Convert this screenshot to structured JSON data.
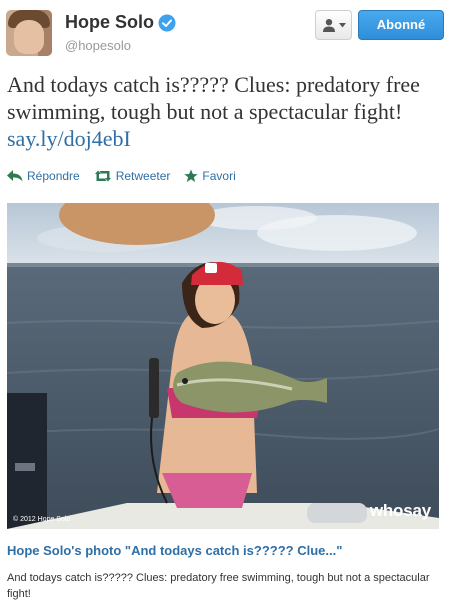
{
  "profile": {
    "name": "Hope Solo",
    "handle": "@hopesolo",
    "verified": true,
    "avatar": "profile-photo"
  },
  "buttons": {
    "user_menu_icon": "user-icon",
    "follow_label": "Abonné"
  },
  "tweet": {
    "text": "And todays catch is????? Clues: predatory free swimming, tough but not a spectacular fight! ",
    "link": "say.ly/doj4ebI"
  },
  "actions": [
    {
      "label": "Répondre",
      "icon": "reply-icon"
    },
    {
      "label": "Retweeter",
      "icon": "retweet-icon"
    },
    {
      "label": "Favori",
      "icon": "star-icon"
    }
  ],
  "media": {
    "copyright": "© 2012 Hope Solo",
    "watermark": "whosay"
  },
  "card": {
    "title": "Hope Solo's photo \"And todays catch is????? Clue...\"",
    "description": "And todays catch is????? Clues: predatory free swimming, tough but not a spectacular fight!"
  },
  "colors": {
    "link": "#2f6fa5",
    "verified": "#3ea1ec",
    "follow_button": "#3a9ae6"
  }
}
